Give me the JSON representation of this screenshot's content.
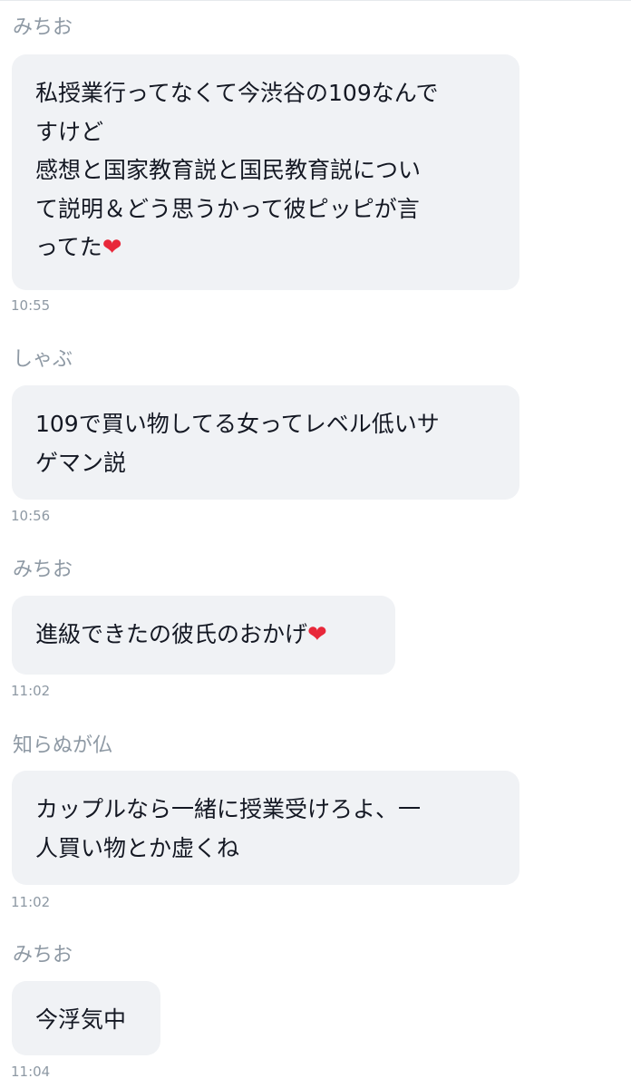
{
  "messages": [
    {
      "sender": "みちお",
      "lines": [
        "私授業行ってなくて今渋谷の109なんで",
        "すけど",
        "感想と国家教育説と国民教育説につい",
        "て説明＆どう思うかって彼ピッピが言",
        "ってた"
      ],
      "emoji": "❤",
      "time": "10:55"
    },
    {
      "sender": "しゃぶ",
      "lines": [
        "109で買い物してる女ってレベル低いサ",
        "ゲマン説"
      ],
      "time": "10:56"
    },
    {
      "sender": "みちお",
      "lines": [
        "進級できたの彼氏のおかげ"
      ],
      "emoji": "❤",
      "time": "11:02"
    },
    {
      "sender": "知らぬが仏",
      "lines": [
        "カップルなら一緒に授業受けろよ、一",
        "人買い物とか虚くね"
      ],
      "time": "11:02"
    },
    {
      "sender": "みちお",
      "lines": [
        "今浮気中"
      ],
      "time": "11:04"
    }
  ],
  "colors": {
    "bubble_background": "#f0f2f5",
    "message_text": "#141823",
    "meta_text": "#8e99a4",
    "heart": "#e8283a"
  }
}
